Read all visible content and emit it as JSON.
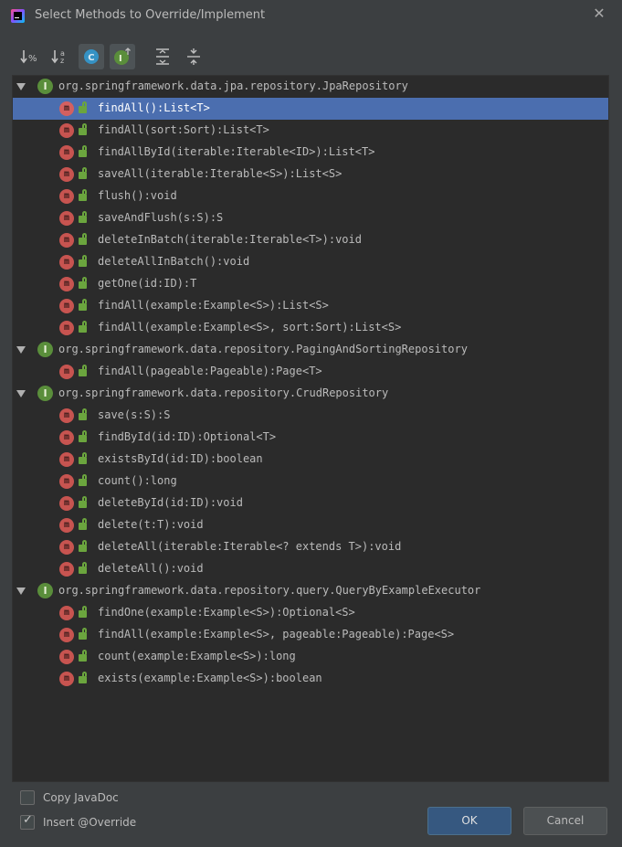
{
  "window": {
    "title": "Select Methods to Override/Implement",
    "app_icon": "intellij-icon",
    "close_icon": "close-icon"
  },
  "toolbar": {
    "buttons": [
      {
        "icon": "sort-by-visibility-icon",
        "active": false
      },
      {
        "icon": "sort-alphabetically-icon",
        "active": false
      },
      {
        "icon": "show-classes-icon",
        "active": true
      },
      {
        "icon": "show-interfaces-icon",
        "active": true
      },
      {
        "icon": "expand-all-icon",
        "active": false
      },
      {
        "icon": "collapse-all-icon",
        "active": false
      }
    ]
  },
  "tree": {
    "groups": [
      {
        "label": "org.springframework.data.jpa.repository.JpaRepository",
        "methods": [
          "findAll():List<T>",
          "findAll(sort:Sort):List<T>",
          "findAllById(iterable:Iterable<ID>):List<T>",
          "saveAll(iterable:Iterable<S>):List<S>",
          "flush():void",
          "saveAndFlush(s:S):S",
          "deleteInBatch(iterable:Iterable<T>):void",
          "deleteAllInBatch():void",
          "getOne(id:ID):T",
          "findAll(example:Example<S>):List<S>",
          "findAll(example:Example<S>, sort:Sort):List<S>"
        ]
      },
      {
        "label": "org.springframework.data.repository.PagingAndSortingRepository",
        "methods": [
          "findAll(pageable:Pageable):Page<T>"
        ]
      },
      {
        "label": "org.springframework.data.repository.CrudRepository",
        "methods": [
          "save(s:S):S",
          "findById(id:ID):Optional<T>",
          "existsById(id:ID):boolean",
          "count():long",
          "deleteById(id:ID):void",
          "delete(t:T):void",
          "deleteAll(iterable:Iterable<? extends T>):void",
          "deleteAll():void"
        ]
      },
      {
        "label": "org.springframework.data.repository.query.QueryByExampleExecutor",
        "methods": [
          "findOne(example:Example<S>):Optional<S>",
          "findAll(example:Example<S>, pageable:Pageable):Page<S>",
          "count(example:Example<S>):long",
          "exists(example:Example<S>):boolean"
        ]
      }
    ],
    "selected_method": "findAll():List<T>",
    "interface_badge": "I",
    "method_badge": "m"
  },
  "options": {
    "copy_javadoc": {
      "label": "Copy JavaDoc",
      "checked": false
    },
    "insert_override": {
      "label": "Insert @Override",
      "checked": true
    }
  },
  "buttons": {
    "ok": "OK",
    "cancel": "Cancel"
  },
  "colors": {
    "background": "#3c3f41",
    "tree_background": "#2b2b2b",
    "selection": "#4b6eaf",
    "method_icon": "#c75450",
    "interface_icon": "#5a8e3b",
    "ok_button": "#365880"
  }
}
